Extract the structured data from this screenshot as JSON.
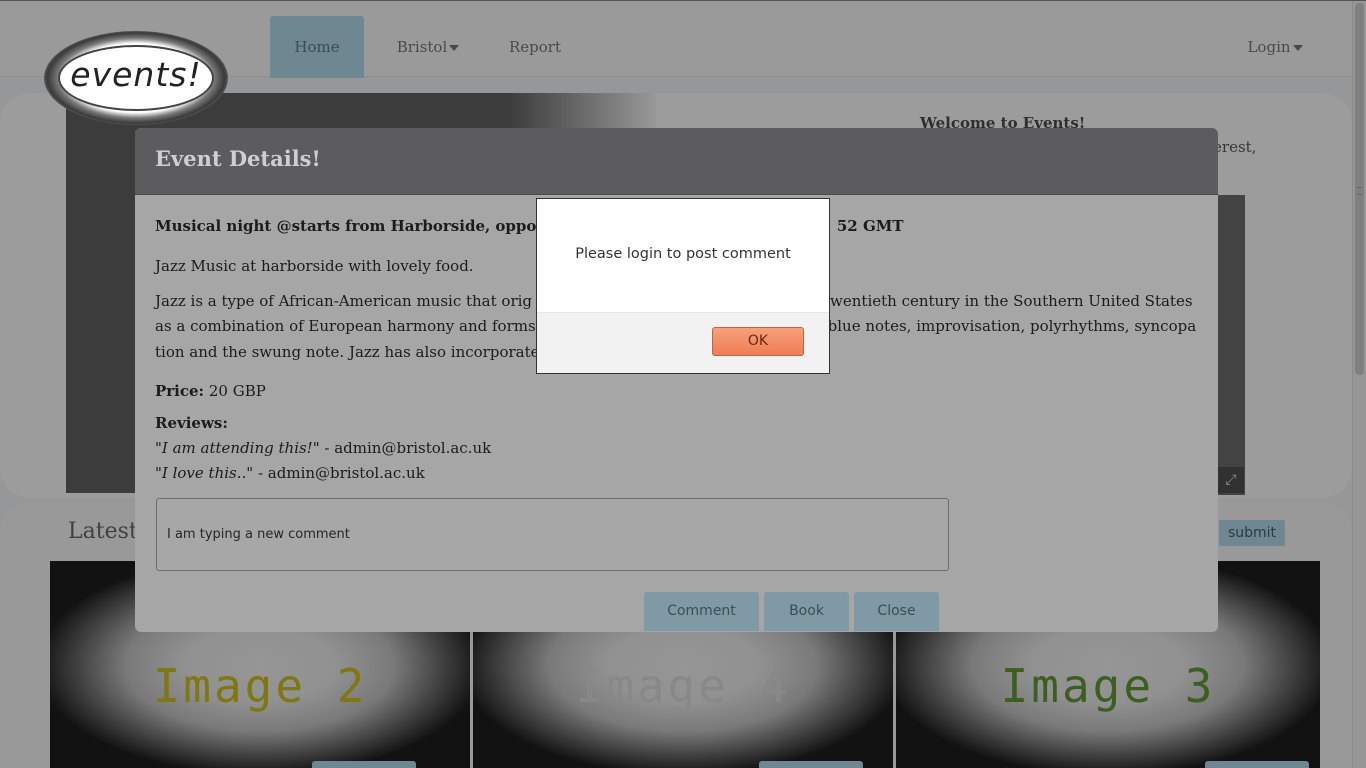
{
  "nav": {
    "logo_text": "events!",
    "home": "Home",
    "bristol": "Bristol",
    "report": "Report",
    "login": "Login"
  },
  "hero": {
    "welcome": "Welcome to Events!",
    "welcome_tail": "terest,"
  },
  "lower": {
    "latest_label": "Latest",
    "submit_label": "submit",
    "tiles": [
      "Image 2",
      "Image 4",
      "Image 3"
    ],
    "tile_colors": [
      "#c6b800",
      "#d8d8d8",
      "#4d8a1c"
    ]
  },
  "modal": {
    "title": "Event Details!",
    "heading_left": "Musical night @starts from Harborside, oppos",
    "heading_right": "52 GMT",
    "short_desc": "Jazz Music at harborside with lovely food.",
    "long_desc_line1_left": "Jazz is a type of African-American music that orig",
    "long_desc_line1_right": "twentieth century in the Southern United States",
    "long_desc_line2_left": "as a combination of European harmony and forms",
    "long_desc_line2_right": "blue notes, improvisation, polyrhythms, syncopa",
    "long_desc_line3": "tion and the swung note. Jazz has also incorporate",
    "price_label": "Price:",
    "price_value": "20 GBP",
    "reviews_label": "Reviews:",
    "reviews": [
      {
        "text": "I am attending this!",
        "author": "admin@bristol.ac.uk"
      },
      {
        "text": "I love this..",
        "author": "admin@bristol.ac.uk"
      }
    ],
    "comment_value": "I am typing a new comment",
    "buttons": {
      "comment": "Comment",
      "book": "Book",
      "close": "Close"
    }
  },
  "alert": {
    "message": "Please login to post comment",
    "ok": "OK"
  }
}
